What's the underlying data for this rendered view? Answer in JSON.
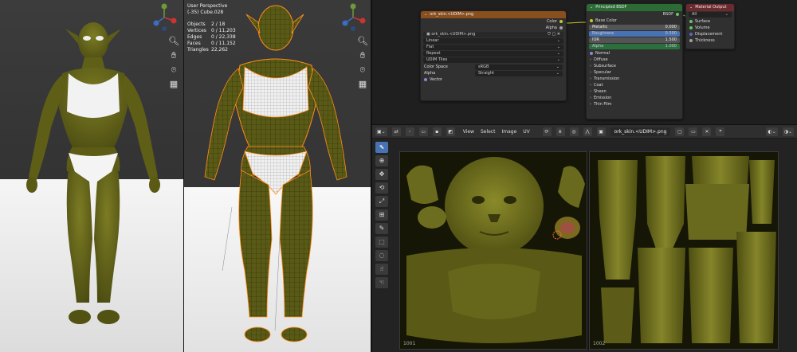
{
  "viewport": {
    "title": "User Perspective",
    "subtitle": "(-35) Cube.028",
    "stats": [
      {
        "key": "Objects",
        "value": "2 / 18"
      },
      {
        "key": "Vertices",
        "value": "0 / 11,203"
      },
      {
        "key": "Edges",
        "value": "0 / 22,338"
      },
      {
        "key": "Faces",
        "value": "0 / 11,152"
      },
      {
        "key": "Triangles",
        "value": "22,262"
      }
    ]
  },
  "image_node": {
    "title": "ork_skin.<UDIM>.png",
    "out_color": "Color",
    "out_alpha": "Alpha",
    "image_name": "ork_skin.<UDIM>.png",
    "interp": "Linear",
    "proj": "Flat",
    "ext": "Repeat",
    "source": "UDIM Tiles",
    "color_space_label": "Color Space",
    "color_space": "sRGB",
    "alpha_label": "Alpha",
    "alpha_mode": "Straight",
    "vector": "Vector"
  },
  "bsdf_node": {
    "title": "Principled BSDF",
    "out": "BSDF",
    "base_color": "Base Color",
    "fields": [
      {
        "label": "Metallic",
        "value": "0.000"
      },
      {
        "label": "Roughness",
        "value": "0.500"
      },
      {
        "label": "IOR",
        "value": "1.500"
      },
      {
        "label": "Alpha",
        "value": "1.000"
      }
    ],
    "normal": "Normal",
    "panels": [
      "Diffuse",
      "Subsurface",
      "Specular",
      "Transmission",
      "Coat",
      "Sheen",
      "Emission",
      "Thin Film"
    ]
  },
  "output_node": {
    "title": "Material Output",
    "target": "All",
    "inputs": [
      "Surface",
      "Volume",
      "Displacement",
      "Thickness"
    ]
  },
  "image_editor": {
    "menus": [
      "View",
      "Select",
      "Image",
      "UV"
    ],
    "image_name": "ork_skin.<UDIM>.png",
    "tiles": [
      "1001",
      "1002"
    ]
  },
  "colors": {
    "skin": "#6b6b1e",
    "accent": "#4772b3",
    "select_orange": "#ff8c1a"
  }
}
